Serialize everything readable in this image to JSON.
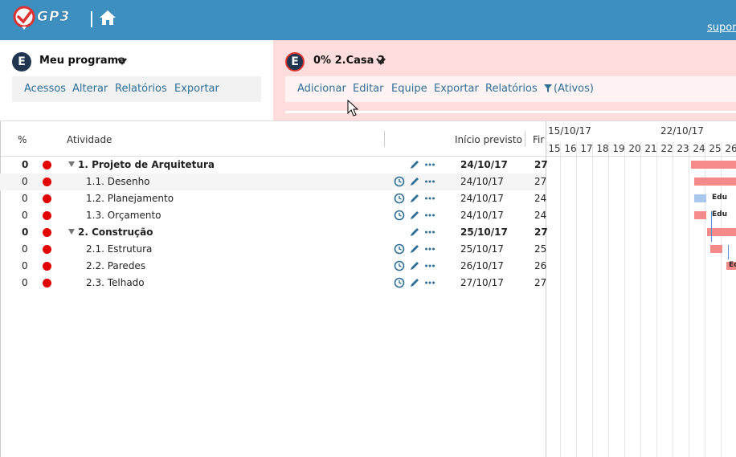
{
  "app": {
    "logo_text": "GP3",
    "support_link": "suporte"
  },
  "program": {
    "badge": "E",
    "title": "Meu programa",
    "menu": [
      "Acessos",
      "Alterar",
      "Relatórios",
      "Exportar"
    ]
  },
  "task": {
    "badge": "E",
    "title": "0% 2.Casa 2",
    "menu": [
      "Adicionar",
      "Editar",
      "Equipe",
      "Exportar",
      "Relatórios"
    ],
    "filter_label": "(Ativos)"
  },
  "grid": {
    "headers": {
      "percent": "%",
      "activity": "Atividade",
      "start": "Início previsto",
      "finish": "Fir"
    },
    "rows": [
      {
        "pct": "0",
        "name": "1. Projeto de Arquitetura",
        "start": "24/10/17",
        "finish": "27",
        "summary": true
      },
      {
        "pct": "0",
        "name": "1.1. Desenho",
        "start": "24/10/17",
        "finish": "27",
        "summary": false
      },
      {
        "pct": "0",
        "name": "1.2. Planejamento",
        "start": "24/10/17",
        "finish": "24",
        "summary": false
      },
      {
        "pct": "0",
        "name": "1.3. Orçamento",
        "start": "24/10/17",
        "finish": "24",
        "summary": false
      },
      {
        "pct": "0",
        "name": "2. Construção",
        "start": "25/10/17",
        "finish": "27",
        "summary": true
      },
      {
        "pct": "0",
        "name": "2.1. Estrutura",
        "start": "25/10/17",
        "finish": "25",
        "summary": false
      },
      {
        "pct": "0",
        "name": "2.2. Paredes",
        "start": "26/10/17",
        "finish": "26",
        "summary": false
      },
      {
        "pct": "0",
        "name": "2.3. Telhado",
        "start": "27/10/17",
        "finish": "27",
        "summary": false
      }
    ]
  },
  "gantt": {
    "weeks": [
      "15/10/17",
      "22/10/17"
    ],
    "days": [
      "15",
      "16",
      "17",
      "18",
      "19",
      "20",
      "21",
      "22",
      "23",
      "24",
      "25",
      "26"
    ],
    "bar_labels": [
      "Edu",
      "Edu",
      "Ed"
    ],
    "colors": {
      "bar": "#f58a8a",
      "milestone": "#a9c8ee",
      "topbar": "#3d8fc0",
      "task_panel": "#ffdddd"
    }
  }
}
